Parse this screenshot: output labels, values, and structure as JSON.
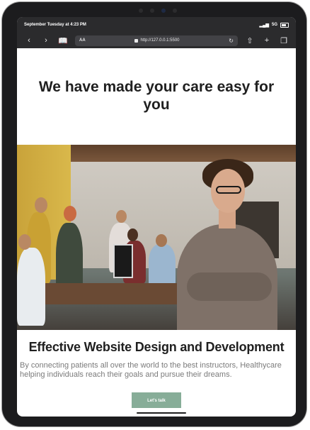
{
  "statusbar": {
    "datetime": "September Tuesday at 4:23 PM",
    "network": "5G"
  },
  "browser": {
    "aa_label": "AA",
    "url": "http://127.0.0.1:5500"
  },
  "hero": {
    "title": "We have made your care easy for you"
  },
  "section": {
    "title": "Effective Website Design and Development",
    "description": "By connecting patients all over the world to the best instructors, Healthycare helping individuals reach their goals and pursue their dreams.",
    "cta_label": "Let's talk"
  },
  "icons": {
    "back": "chevron-left-icon",
    "forward": "chevron-right-icon",
    "bookmarks": "book-icon",
    "lock": "lock-icon",
    "reload": "reload-icon",
    "share": "share-icon",
    "new_tab": "plus-icon",
    "tabs": "tabs-icon"
  },
  "colors": {
    "cta_background": "#87ad98",
    "title_text": "#202020",
    "description_text": "#7b7b7b"
  }
}
